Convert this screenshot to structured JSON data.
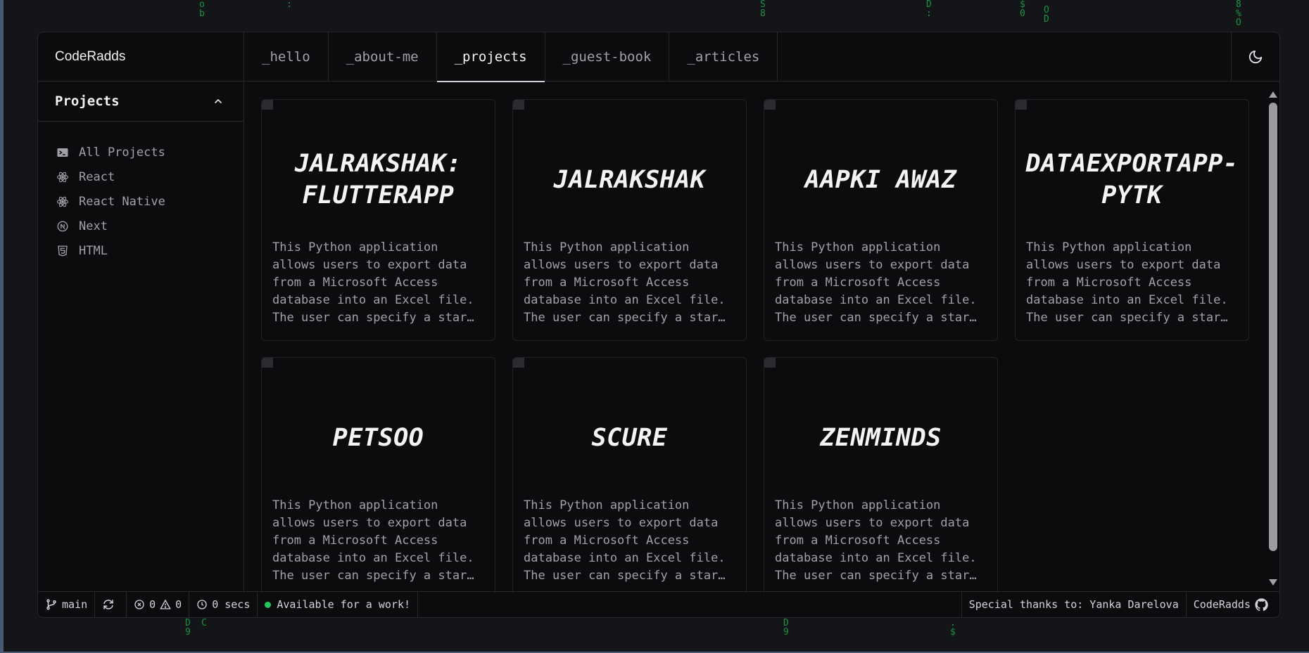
{
  "app": {
    "brand": "CodeRadds"
  },
  "tabs": [
    {
      "label": "_hello",
      "active": false
    },
    {
      "label": "_about-me",
      "active": false
    },
    {
      "label": "_projects",
      "active": true
    },
    {
      "label": "_guest-book",
      "active": false
    },
    {
      "label": "_articles",
      "active": false
    }
  ],
  "theme_toggle": {
    "icon": "moon-icon"
  },
  "sidebar": {
    "title": "Projects",
    "collapse_icon": "chevron-up-icon",
    "items": [
      {
        "label": "All Projects",
        "icon": "terminal-icon"
      },
      {
        "label": "React",
        "icon": "react-icon"
      },
      {
        "label": "React Native",
        "icon": "react-icon"
      },
      {
        "label": "Next",
        "icon": "nextjs-icon"
      },
      {
        "label": "HTML",
        "icon": "html5-icon"
      }
    ]
  },
  "projects": [
    {
      "title_lines": [
        "JALRAKSHAK:",
        "FLUTTERAPP"
      ],
      "desc": [
        "This Python application",
        "allows users to export data",
        "from a Microsoft Access",
        "database into an Excel file.",
        "The user can specify a star…"
      ]
    },
    {
      "title_lines": [
        "JALRAKSHAK"
      ],
      "desc": [
        "This Python application",
        "allows users to export data",
        "from a Microsoft Access",
        "database into an Excel file.",
        "The user can specify a star…"
      ]
    },
    {
      "title_lines": [
        "AAPKI AWAZ"
      ],
      "desc": [
        "This Python application",
        "allows users to export data",
        "from a Microsoft Access",
        "database into an Excel file.",
        "The user can specify a star…"
      ]
    },
    {
      "title_lines": [
        "DATAEXPORTAPP-",
        "PYTK"
      ],
      "desc": [
        "This Python application",
        "allows users to export data",
        "from a Microsoft Access",
        "database into an Excel file.",
        "The user can specify a star…"
      ]
    },
    {
      "title_lines": [
        "PETSOO"
      ],
      "desc": [
        "This Python application",
        "allows users to export data",
        "from a Microsoft Access",
        "database into an Excel file.",
        "The user can specify a star…"
      ]
    },
    {
      "title_lines": [
        "SCURE"
      ],
      "desc": [
        "This Python application",
        "allows users to export data",
        "from a Microsoft Access",
        "database into an Excel file.",
        "The user can specify a star…"
      ]
    },
    {
      "title_lines": [
        "ZENMINDS"
      ],
      "desc": [
        "This Python application",
        "allows users to export data",
        "from a Microsoft Access",
        "database into an Excel file.",
        "The user can specify a star…"
      ]
    }
  ],
  "statusbar": {
    "branch": "main",
    "errors": "0",
    "warnings": "0",
    "time": "0 secs",
    "availability": "Available for a work!",
    "thanks": "Special thanks to: Yanka Darelova",
    "repo": "CodeRadds",
    "status_color": "#22c55e"
  }
}
